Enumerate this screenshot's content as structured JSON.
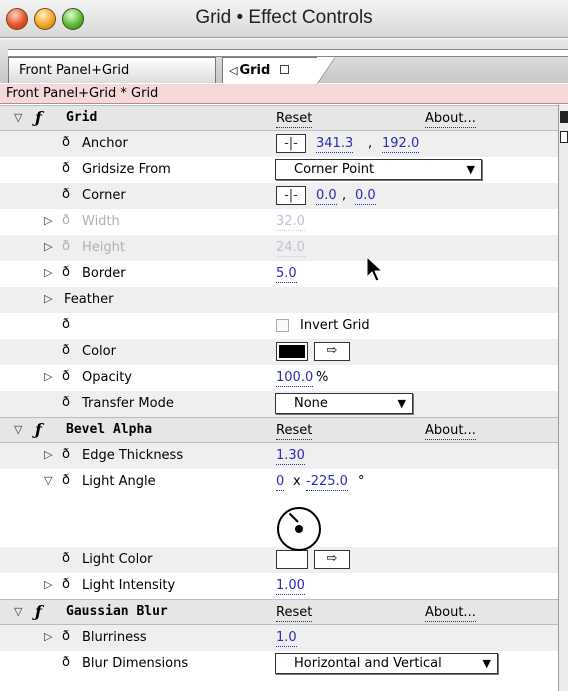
{
  "window": {
    "title": "Grid • Effect Controls"
  },
  "tabs": [
    {
      "label": "Front Panel+Grid"
    },
    {
      "label": "Grid"
    }
  ],
  "breadcrumb": "Front Panel+Grid * Grid",
  "common": {
    "reset": "Reset",
    "about": "About...",
    "cross": "-|-",
    "dropper": "⇨"
  },
  "grid": {
    "name": "Grid",
    "anchor": {
      "label": "Anchor",
      "x": "341.3",
      "sep": ",",
      "y": "192.0"
    },
    "gridsize": {
      "label": "Gridsize From",
      "value": "Corner Point"
    },
    "corner": {
      "label": "Corner",
      "x": "0.0",
      "sep": ",",
      "y": "0.0"
    },
    "width": {
      "label": "Width",
      "value": "32.0"
    },
    "height": {
      "label": "Height",
      "value": "24.0"
    },
    "border": {
      "label": "Border",
      "value": "5.0"
    },
    "feather": {
      "label": "Feather"
    },
    "invert": {
      "label": "Invert Grid"
    },
    "color": {
      "label": "Color",
      "swatch": "#000000"
    },
    "opacity": {
      "label": "Opacity",
      "value": "100.0",
      "unit": "%"
    },
    "transfer": {
      "label": "Transfer Mode",
      "value": "None"
    }
  },
  "bevel": {
    "name": "Bevel Alpha",
    "edge": {
      "label": "Edge Thickness",
      "value": "1.30"
    },
    "angle": {
      "label": "Light Angle",
      "rev": "0",
      "times": "x",
      "deg": "-225.0",
      "unit": "°"
    },
    "lightcolor": {
      "label": "Light Color",
      "swatch": "#ffffff"
    },
    "intensity": {
      "label": "Light Intensity",
      "value": "1.00"
    }
  },
  "blur": {
    "name": "Gaussian Blur",
    "blurriness": {
      "label": "Blurriness",
      "value": "1.0"
    },
    "dimensions": {
      "label": "Blur Dimensions",
      "value": "Horizontal and Vertical"
    }
  }
}
